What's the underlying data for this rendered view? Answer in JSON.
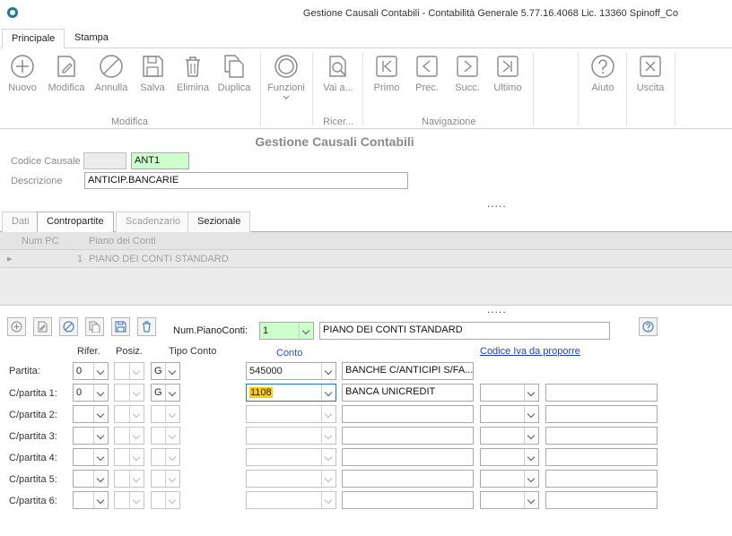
{
  "window": {
    "title": "Gestione Causali Contabili - Contabilità Generale 5.77.16.4068 Lic. 13360 Spinoff_Co"
  },
  "ribbon": {
    "tabs": [
      {
        "label": "Principale",
        "active": true
      },
      {
        "label": "Stampa",
        "active": false
      }
    ],
    "buttons": {
      "nuovo": "Nuovo",
      "modifica": "Modifica",
      "annulla": "Annulla",
      "salva": "Salva",
      "elimina": "Elimina",
      "duplica": "Duplica",
      "funzioni": "Funzioni",
      "vai": "Vai a...",
      "primo": "Primo",
      "prec": "Prec.",
      "succ": "Succ.",
      "ultimo": "Ultimo",
      "aiuto": "Aiuto",
      "uscita": "Uscita"
    },
    "groups": {
      "modifica": "Modifica",
      "ricerca": "Ricer...",
      "navigazione": "Navigazione"
    }
  },
  "form": {
    "title": "Gestione Causali Contabili",
    "codice_label": "Codice Causale",
    "codice_prefix": "",
    "codice_value": "ANT1",
    "descrizione_label": "Descrizione",
    "descrizione_value": "ANTICIP.BANCARIE",
    "dots": "....."
  },
  "tabs": [
    {
      "label": "Dati",
      "active": false
    },
    {
      "label": "Contropartite",
      "active": true
    },
    {
      "label": "Scadenzario",
      "active": false
    },
    {
      "label": "Sezionale",
      "active": false
    }
  ],
  "grid": {
    "columns": [
      "Num PC",
      "Piano dei Conti"
    ],
    "rows": [
      {
        "num": "1",
        "piano": "PIANO DEI CONTI STANDARD"
      }
    ]
  },
  "contropartite": {
    "num_piano_label": "Num.PianoConti:",
    "num_piano_value": "1",
    "piano_desc": "PIANO DEI CONTI STANDARD",
    "headers": {
      "rifer": "Rifer.",
      "posiz": "Posiz.",
      "tipo_conto": "Tipo Conto",
      "conto": "Conto",
      "codice_iva": "Codice Iva da proporre"
    },
    "rows": [
      {
        "label": "Partita:",
        "rifer": "0",
        "posiz": "",
        "tipo": "G",
        "conto": "545000",
        "desc": "BANCHE C/ANTICIPI S/FA...",
        "iva": "",
        "iva_desc": ""
      },
      {
        "label": "C/partita 1:",
        "rifer": "0",
        "posiz": "",
        "tipo": "G",
        "conto": "1108",
        "desc": "BANCA UNICREDIT",
        "iva": "",
        "iva_desc": ""
      },
      {
        "label": "C/partita 2:",
        "rifer": "",
        "posiz": "",
        "tipo": "",
        "conto": "",
        "desc": "",
        "iva": "",
        "iva_desc": ""
      },
      {
        "label": "C/partita 3:",
        "rifer": "",
        "posiz": "",
        "tipo": "",
        "conto": "",
        "desc": "",
        "iva": "",
        "iva_desc": ""
      },
      {
        "label": "C/partita 4:",
        "rifer": "",
        "posiz": "",
        "tipo": "",
        "conto": "",
        "desc": "",
        "iva": "",
        "iva_desc": ""
      },
      {
        "label": "C/partita 5:",
        "rifer": "",
        "posiz": "",
        "tipo": "",
        "conto": "",
        "desc": "",
        "iva": "",
        "iva_desc": ""
      },
      {
        "label": "C/partita 6:",
        "rifer": "",
        "posiz": "",
        "tipo": "",
        "conto": "",
        "desc": "",
        "iva": "",
        "iva_desc": ""
      }
    ]
  },
  "colors": {
    "green_field": "#ccffcc",
    "highlight": "#ffcc00",
    "link_blue": "#1f3fbf"
  }
}
